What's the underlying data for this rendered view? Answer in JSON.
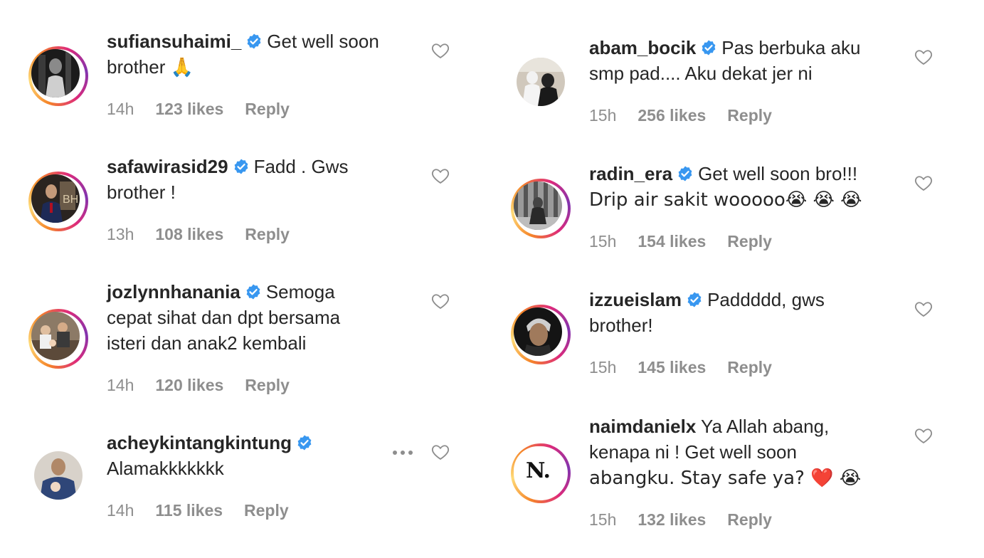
{
  "left_column": [
    {
      "username": "sufiansuhaimi_",
      "verified": true,
      "text_line1": "Get well soon",
      "text_line2": "brother 🙏",
      "time": "14h",
      "likes": "123 likes",
      "reply": "Reply",
      "story_ring": true
    },
    {
      "username": "safawirasid29",
      "verified": true,
      "text_line1": "Fadd . Gws",
      "text_line2": "brother !",
      "time": "13h",
      "likes": "108 likes",
      "reply": "Reply",
      "story_ring": true
    },
    {
      "username": "jozlynnhanania",
      "verified": true,
      "text_line1": "Semoga",
      "text_line2": "cepat sihat dan dpt bersama",
      "text_line3": "isteri dan anak2 kembali",
      "time": "14h",
      "likes": "120 likes",
      "reply": "Reply",
      "story_ring": true
    },
    {
      "username": "acheykintangkintung",
      "verified": true,
      "text_line1": "",
      "text_line2": "Alamakkkkkkk",
      "time": "14h",
      "likes": "115 likes",
      "reply": "Reply",
      "story_ring": false
    }
  ],
  "right_column": [
    {
      "username": "abam_bocik",
      "verified": true,
      "text_line1": "Pas berbuka aku",
      "text_line2": "smp pad.... Aku dekat jer ni",
      "time": "15h",
      "likes": "256 likes",
      "reply": "Reply",
      "story_ring": false
    },
    {
      "username": "radin_era",
      "verified": true,
      "text_line1": "Get well soon bro!!!",
      "text_line2": "Drip air sakit wooooo😭 😭 😭",
      "time": "15h",
      "likes": "154 likes",
      "reply": "Reply",
      "story_ring": true
    },
    {
      "username": "izzueislam",
      "verified": true,
      "text_line1": "Paddddd, gws",
      "text_line2": "brother!",
      "time": "15h",
      "likes": "145 likes",
      "reply": "Reply",
      "story_ring": true
    },
    {
      "username": "naimdanielx",
      "verified": false,
      "text_line1": "Ya Allah abang,",
      "text_line2": "kenapa ni ! Get well soon",
      "text_line3": "abangku. Stay safe ya? ❤️ 😭",
      "time": "15h",
      "likes": "132 likes",
      "reply": "Reply",
      "story_ring": true,
      "avatar_letters": "N."
    }
  ],
  "colors": {
    "text": "#262626",
    "meta": "#8e8e8e",
    "verified": "#3897f0",
    "heart_outline": "#8e8e8e"
  }
}
